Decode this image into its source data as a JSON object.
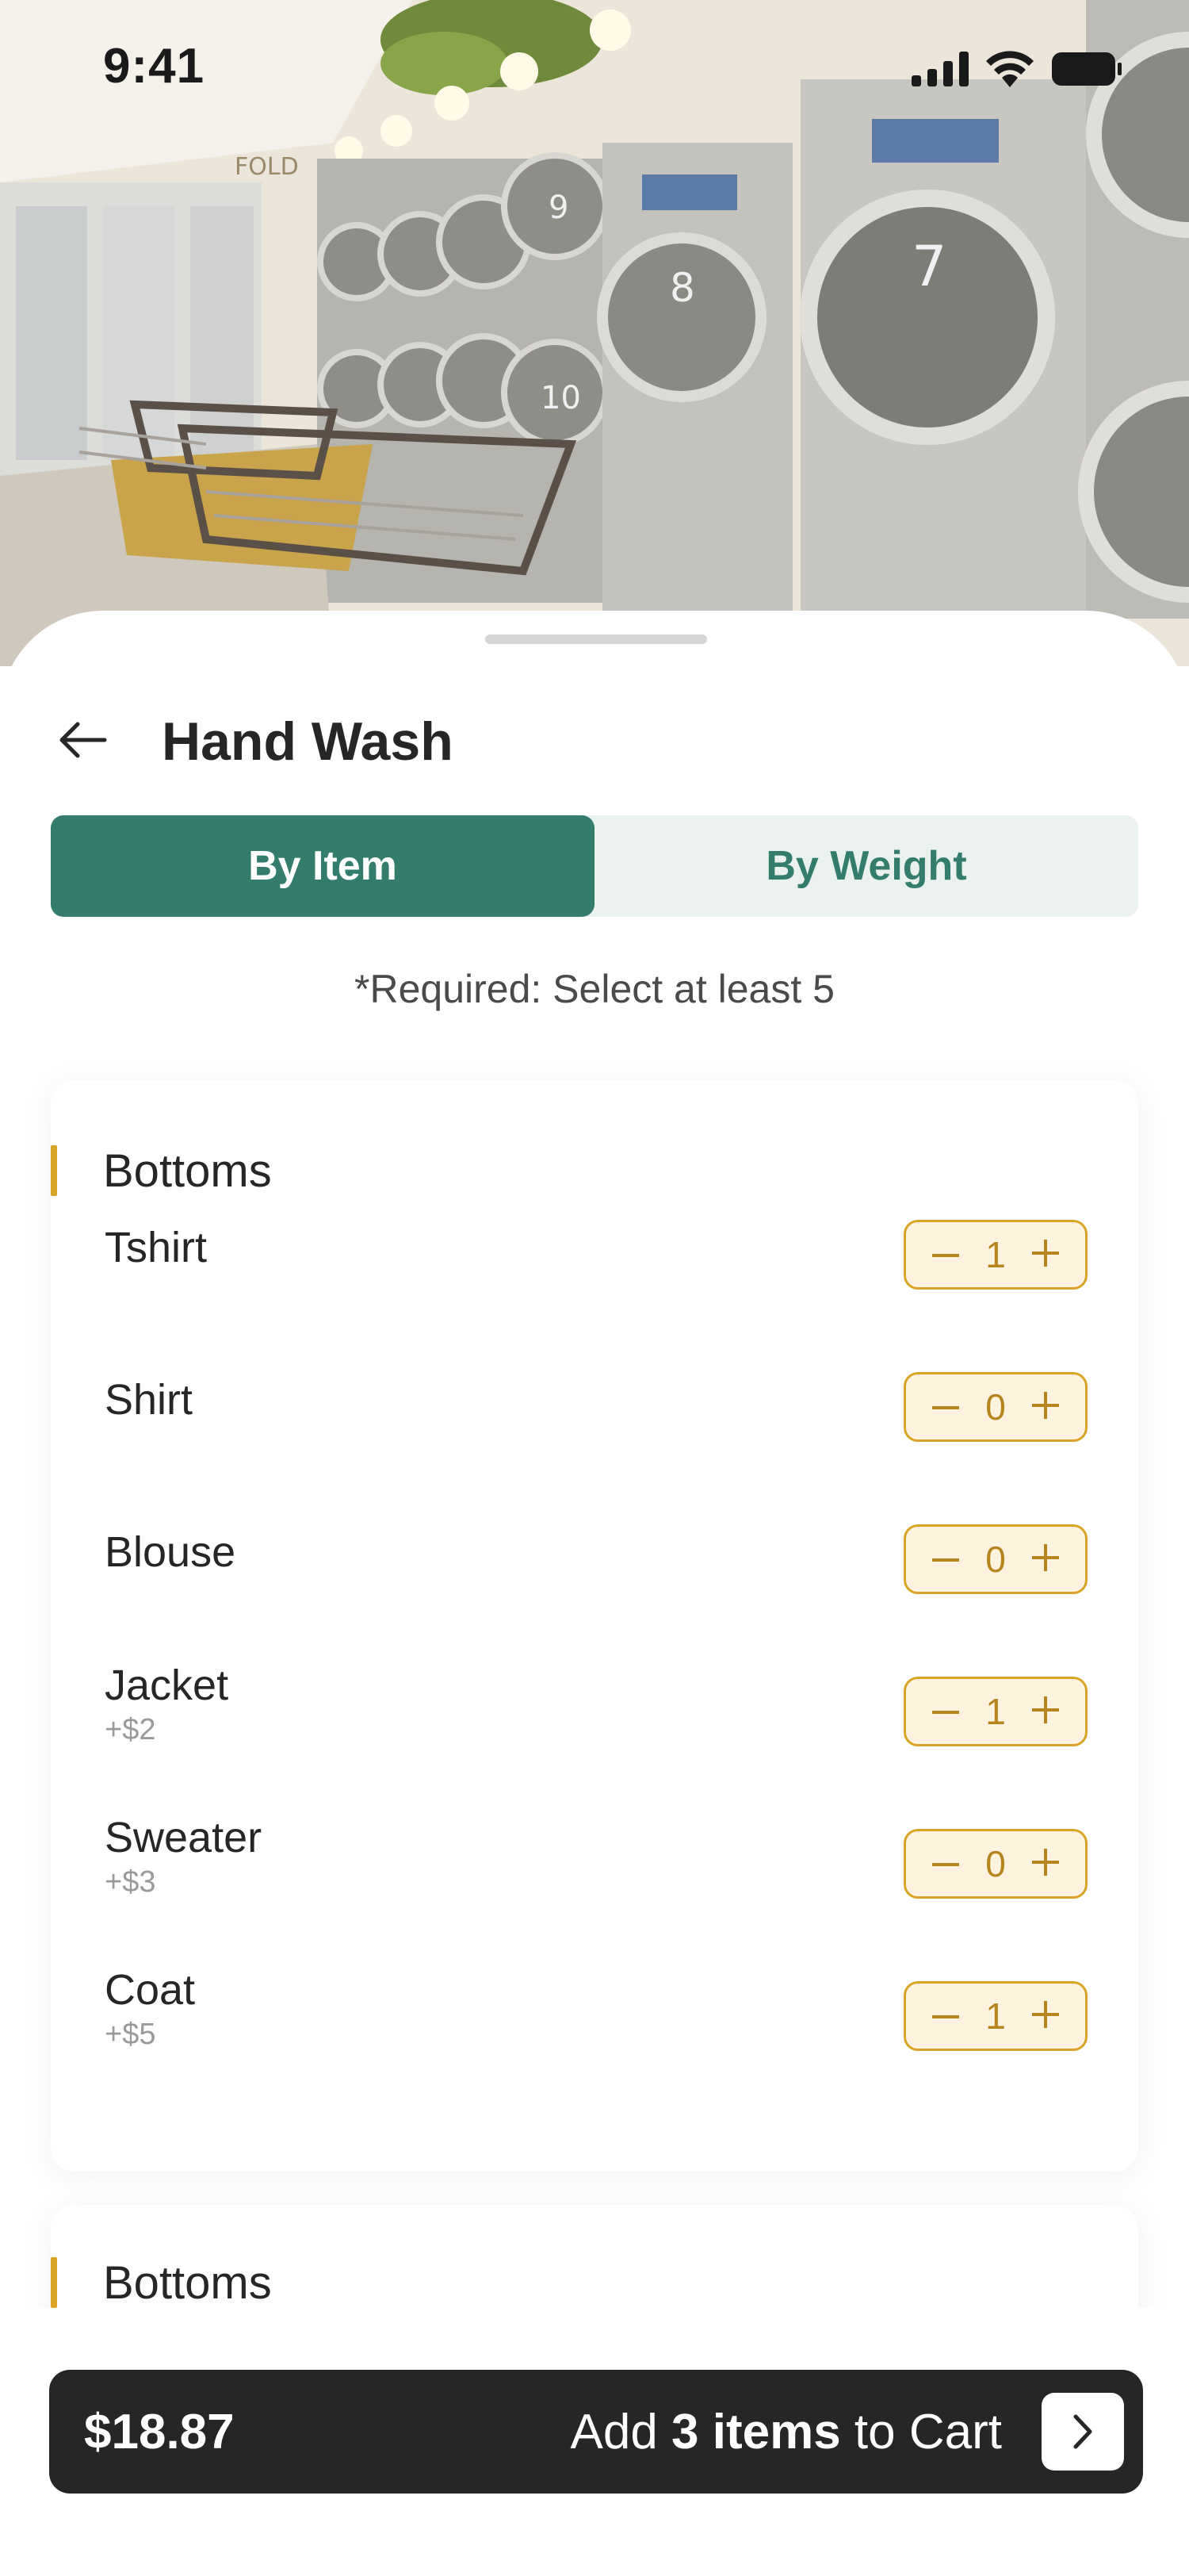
{
  "status_bar": {
    "time": "9:41"
  },
  "header": {
    "title": "Hand Wash"
  },
  "segment": {
    "by_item": "By Item",
    "by_weight": "By Weight",
    "selected": "By Item"
  },
  "required_note": "*Required: Select at least 5",
  "categories": [
    {
      "title": "Bottoms",
      "items": [
        {
          "name": "Tshirt",
          "extra": "",
          "qty": "1"
        },
        {
          "name": "Shirt",
          "extra": "",
          "qty": "0"
        },
        {
          "name": "Blouse",
          "extra": "",
          "qty": "0"
        },
        {
          "name": "Jacket",
          "extra": "+$2",
          "qty": "1"
        },
        {
          "name": "Sweater",
          "extra": "+$3",
          "qty": "0"
        },
        {
          "name": "Coat",
          "extra": "+$5",
          "qty": "1"
        }
      ]
    },
    {
      "title": "Bottoms",
      "items": []
    }
  ],
  "cart": {
    "price": "$18.87",
    "prefix": "Add ",
    "count_text": "3 items",
    "suffix": " to Cart"
  },
  "hero_sign": "FOLD",
  "machine_numbers": [
    "9",
    "8",
    "7",
    "10"
  ],
  "colors": {
    "primary": "#347d6c",
    "accent": "#d9a326",
    "stepper_bg": "#fdf3df",
    "dark": "#262626",
    "segment_bg": "#eaf1ef"
  },
  "icons": [
    "signal-icon",
    "wifi-icon",
    "battery-icon",
    "back-arrow-icon",
    "minus-icon",
    "plus-icon",
    "chevron-right-icon"
  ]
}
